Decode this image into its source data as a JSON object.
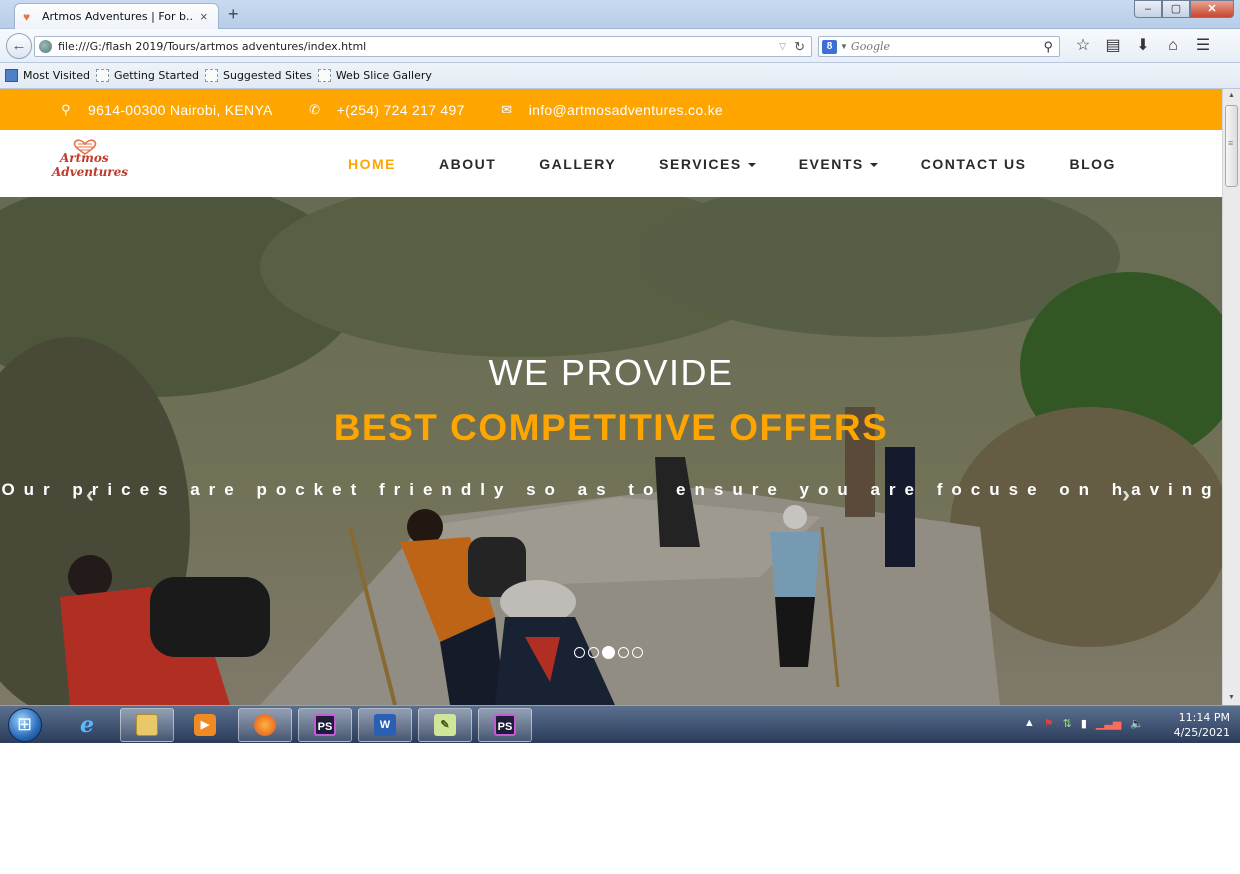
{
  "browser": {
    "tab": {
      "title": "Artmos Adventures | For b...",
      "close": "×"
    },
    "new_tab": "+",
    "window_buttons": {
      "minimize": "–",
      "maximize": "▢",
      "close": "✕"
    },
    "url": "file:///G:/flash 2019/Tours/artmos adventures/index.html",
    "search_placeholder": "Google",
    "bookmarks": [
      "Most Visited",
      "Getting Started",
      "Suggested Sites",
      "Web Slice Gallery"
    ]
  },
  "site": {
    "topbar": {
      "address": "9614-00300 Nairobi, KENYA",
      "phone": "+(254) 724 217 497",
      "email": "info@artmosadventures.co.ke"
    },
    "logo": {
      "line1": "Artmos",
      "line2": "Adventures"
    },
    "menu": [
      {
        "label": "HOME",
        "active": true,
        "dropdown": false
      },
      {
        "label": "ABOUT",
        "active": false,
        "dropdown": false
      },
      {
        "label": "GALLERY",
        "active": false,
        "dropdown": false
      },
      {
        "label": "SERVICES",
        "active": false,
        "dropdown": true
      },
      {
        "label": "EVENTS",
        "active": false,
        "dropdown": true
      },
      {
        "label": "CONTACT US",
        "active": false,
        "dropdown": false
      },
      {
        "label": "BLOG",
        "active": false,
        "dropdown": false
      }
    ],
    "hero": {
      "line1": "WE PROVIDE",
      "line2": "BEST COMPETITIVE OFFERS",
      "line3": "Our prices are pocket friendly so as to ensure you are focuse on having",
      "arrow_left": "‹",
      "arrow_right": "›",
      "slide_count": 5,
      "active_slide": 3
    }
  },
  "taskbar": {
    "apps": [
      "ie",
      "explorer",
      "media",
      "firefox",
      "PS",
      "W",
      "notepad",
      "PS"
    ],
    "time": "11:14 PM",
    "date": "4/25/2021"
  },
  "colors": {
    "accent": "#ffa500",
    "chrome": "#dce6f2",
    "nav_text": "#2a2a2a"
  }
}
